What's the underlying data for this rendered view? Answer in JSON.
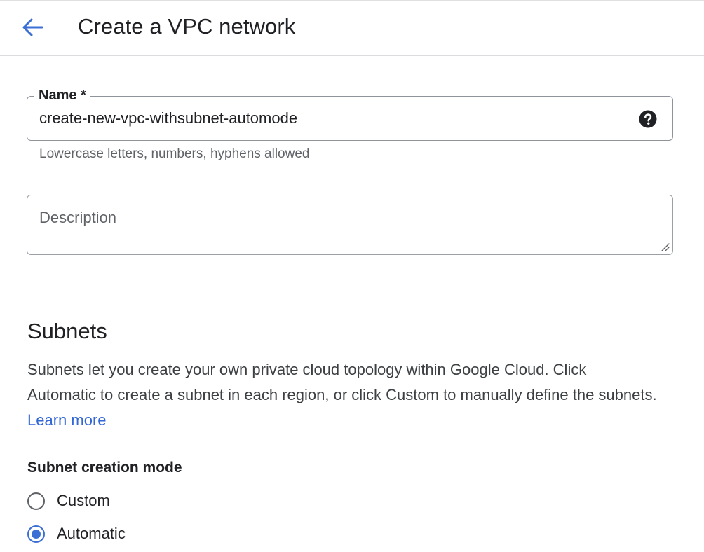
{
  "header": {
    "back_icon": "arrow-left-icon",
    "title": "Create a VPC network"
  },
  "name_field": {
    "label": "Name *",
    "value": "create-new-vpc-withsubnet-automode",
    "help_icon": "help-circle-icon",
    "hint": "Lowercase letters, numbers, hyphens allowed"
  },
  "description_field": {
    "placeholder": "Description",
    "value": ""
  },
  "subnets": {
    "title": "Subnets",
    "description": "Subnets let you create your own private cloud topology within Google Cloud. Click Automatic to create a subnet in each region, or click Custom to manually define the subnets.",
    "learn_more": "Learn more",
    "mode_label": "Subnet creation mode",
    "options": [
      {
        "label": "Custom",
        "selected": false
      },
      {
        "label": "Automatic",
        "selected": true
      }
    ]
  },
  "colors": {
    "accent": "#3b6fd4",
    "text": "#202124",
    "secondary_text": "#5f6368",
    "border": "#9aa0a6"
  }
}
